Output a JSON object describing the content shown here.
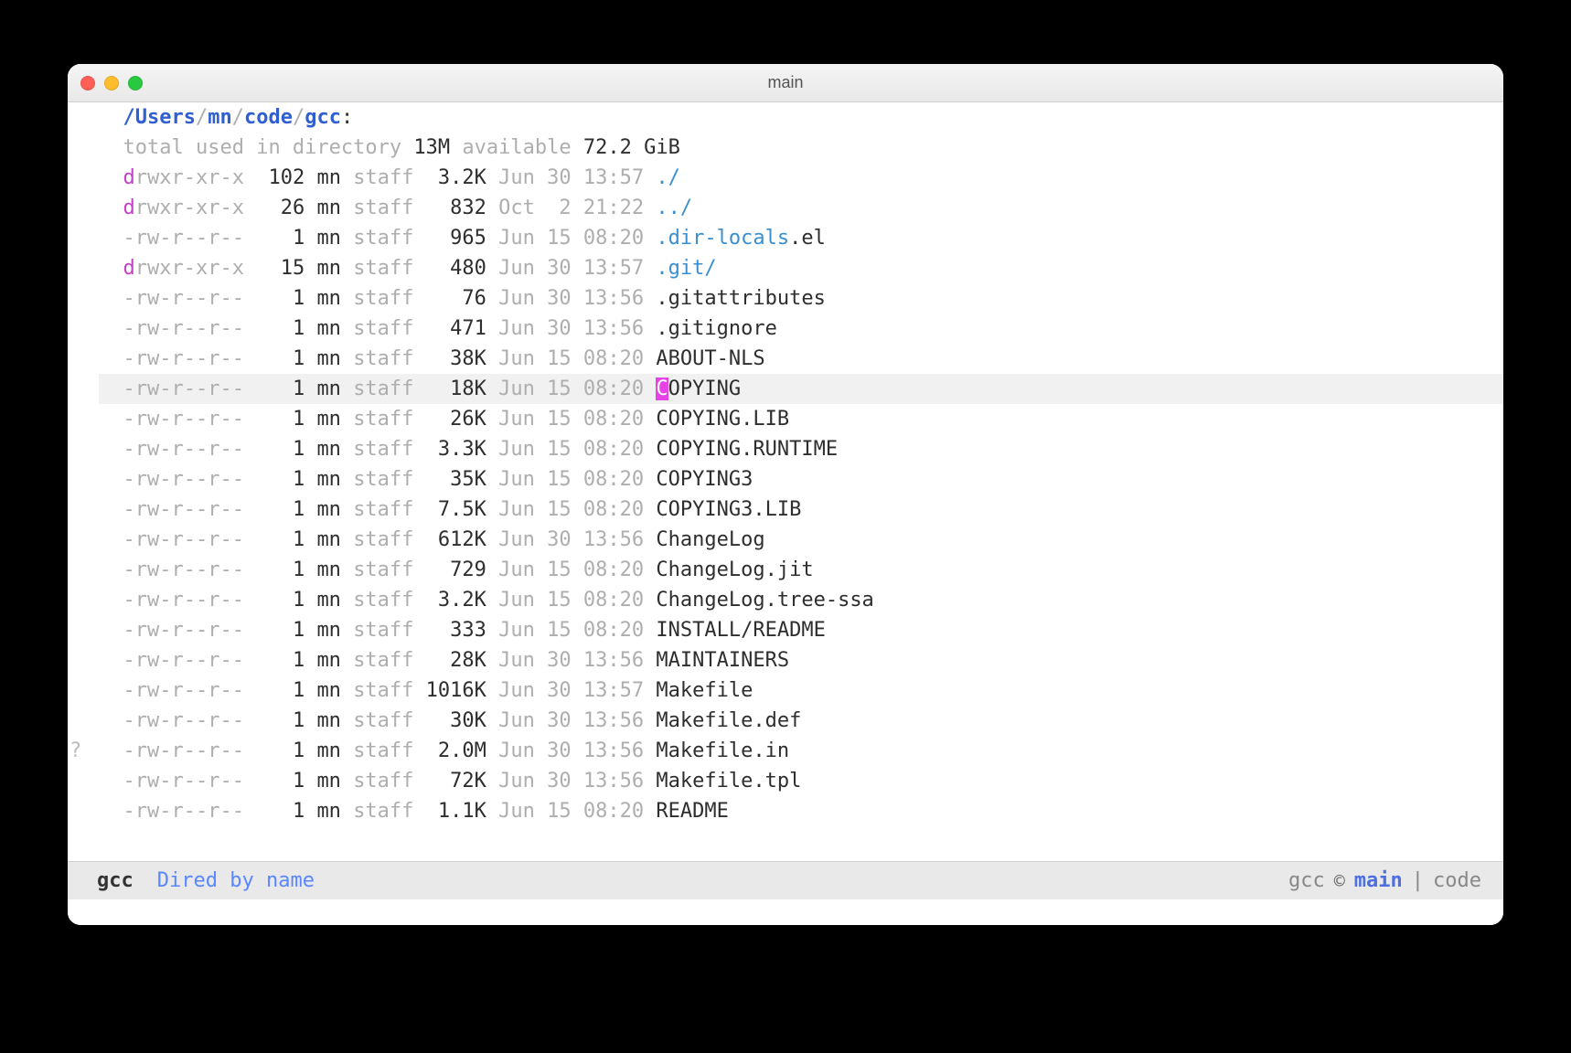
{
  "window": {
    "title": "main"
  },
  "path": {
    "sep": "/",
    "segments": [
      "Users",
      "mn",
      "code",
      "gcc"
    ],
    "suffix": ":"
  },
  "summary": {
    "prefix": "total used in directory ",
    "used": "13M",
    "mid": " available ",
    "avail": "72.2",
    "unit": " GiB"
  },
  "cols": {
    "links_start": 12,
    "links_end": 16,
    "size_start": 32,
    "size_end": 38,
    "name_start": 55
  },
  "cursor_row": 7,
  "gutter_mark_row": 19,
  "gutter_mark_char": "?",
  "entries": [
    {
      "perm": "drwxr-xr-x",
      "links": "102",
      "user": "mn",
      "group": "staff",
      "size": "3.2K",
      "month": "Jun",
      "day": "30",
      "time": "13:57",
      "name": "./",
      "type": "dir"
    },
    {
      "perm": "drwxr-xr-x",
      "links": "26",
      "user": "mn",
      "group": "staff",
      "size": "832",
      "month": "Oct",
      "day": " 2",
      "time": "21:22",
      "name": "../",
      "type": "dir"
    },
    {
      "perm": "-rw-r--r--",
      "links": "1",
      "user": "mn",
      "group": "staff",
      "size": "965",
      "month": "Jun",
      "day": "15",
      "time": "08:20",
      "name_pre": ".dir-locals",
      "name_post": ".el",
      "type": "dotfile"
    },
    {
      "perm": "drwxr-xr-x",
      "links": "15",
      "user": "mn",
      "group": "staff",
      "size": "480",
      "month": "Jun",
      "day": "30",
      "time": "13:57",
      "name_pre": ".git",
      "name_post": "/",
      "type": "dotdir"
    },
    {
      "perm": "-rw-r--r--",
      "links": "1",
      "user": "mn",
      "group": "staff",
      "size": "76",
      "month": "Jun",
      "day": "30",
      "time": "13:56",
      "name": ".gitattributes",
      "type": "file"
    },
    {
      "perm": "-rw-r--r--",
      "links": "1",
      "user": "mn",
      "group": "staff",
      "size": "471",
      "month": "Jun",
      "day": "30",
      "time": "13:56",
      "name": ".gitignore",
      "type": "file"
    },
    {
      "perm": "-rw-r--r--",
      "links": "1",
      "user": "mn",
      "group": "staff",
      "size": "38K",
      "month": "Jun",
      "day": "15",
      "time": "08:20",
      "name": "ABOUT-NLS",
      "type": "file"
    },
    {
      "perm": "-rw-r--r--",
      "links": "1",
      "user": "mn",
      "group": "staff",
      "size": "18K",
      "month": "Jun",
      "day": "15",
      "time": "08:20",
      "name": "COPYING",
      "type": "file"
    },
    {
      "perm": "-rw-r--r--",
      "links": "1",
      "user": "mn",
      "group": "staff",
      "size": "26K",
      "month": "Jun",
      "day": "15",
      "time": "08:20",
      "name": "COPYING.LIB",
      "type": "file"
    },
    {
      "perm": "-rw-r--r--",
      "links": "1",
      "user": "mn",
      "group": "staff",
      "size": "3.3K",
      "month": "Jun",
      "day": "15",
      "time": "08:20",
      "name": "COPYING.RUNTIME",
      "type": "file"
    },
    {
      "perm": "-rw-r--r--",
      "links": "1",
      "user": "mn",
      "group": "staff",
      "size": "35K",
      "month": "Jun",
      "day": "15",
      "time": "08:20",
      "name": "COPYING3",
      "type": "file"
    },
    {
      "perm": "-rw-r--r--",
      "links": "1",
      "user": "mn",
      "group": "staff",
      "size": "7.5K",
      "month": "Jun",
      "day": "15",
      "time": "08:20",
      "name": "COPYING3.LIB",
      "type": "file"
    },
    {
      "perm": "-rw-r--r--",
      "links": "1",
      "user": "mn",
      "group": "staff",
      "size": "612K",
      "month": "Jun",
      "day": "30",
      "time": "13:56",
      "name": "ChangeLog",
      "type": "file"
    },
    {
      "perm": "-rw-r--r--",
      "links": "1",
      "user": "mn",
      "group": "staff",
      "size": "729",
      "month": "Jun",
      "day": "15",
      "time": "08:20",
      "name": "ChangeLog.jit",
      "type": "file"
    },
    {
      "perm": "-rw-r--r--",
      "links": "1",
      "user": "mn",
      "group": "staff",
      "size": "3.2K",
      "month": "Jun",
      "day": "15",
      "time": "08:20",
      "name": "ChangeLog.tree-ssa",
      "type": "file"
    },
    {
      "perm": "-rw-r--r--",
      "links": "1",
      "user": "mn",
      "group": "staff",
      "size": "333",
      "month": "Jun",
      "day": "15",
      "time": "08:20",
      "name": "INSTALL/README",
      "type": "file"
    },
    {
      "perm": "-rw-r--r--",
      "links": "1",
      "user": "mn",
      "group": "staff",
      "size": "28K",
      "month": "Jun",
      "day": "30",
      "time": "13:56",
      "name": "MAINTAINERS",
      "type": "file"
    },
    {
      "perm": "-rw-r--r--",
      "links": "1",
      "user": "mn",
      "group": "staff",
      "size": "1016K",
      "month": "Jun",
      "day": "30",
      "time": "13:57",
      "name": "Makefile",
      "type": "file"
    },
    {
      "perm": "-rw-r--r--",
      "links": "1",
      "user": "mn",
      "group": "staff",
      "size": "30K",
      "month": "Jun",
      "day": "30",
      "time": "13:56",
      "name": "Makefile.def",
      "type": "file"
    },
    {
      "perm": "-rw-r--r--",
      "links": "1",
      "user": "mn",
      "group": "staff",
      "size": "2.0M",
      "month": "Jun",
      "day": "30",
      "time": "13:56",
      "name": "Makefile.in",
      "type": "file"
    },
    {
      "perm": "-rw-r--r--",
      "links": "1",
      "user": "mn",
      "group": "staff",
      "size": "72K",
      "month": "Jun",
      "day": "30",
      "time": "13:56",
      "name": "Makefile.tpl",
      "type": "file"
    },
    {
      "perm": "-rw-r--r--",
      "links": "1",
      "user": "mn",
      "group": "staff",
      "size": "1.1K",
      "month": "Jun",
      "day": "15",
      "time": "08:20",
      "name": "README",
      "type": "file"
    }
  ],
  "modeline": {
    "buffer": "gcc",
    "mode": "Dired by name",
    "project": "gcc",
    "branch_glyph": "©",
    "branch": "main",
    "pipe": "|",
    "extra": "code"
  }
}
